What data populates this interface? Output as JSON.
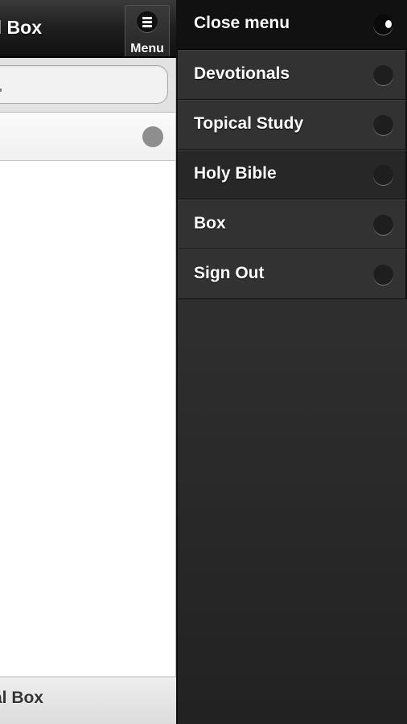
{
  "header": {
    "title": "l Box",
    "menu_button_label": "Menu",
    "menu_icon": "hamburger-icon"
  },
  "search": {
    "value": "",
    "placeholder": "",
    "icon": "search-icon"
  },
  "list": {
    "items": [
      {
        "label": "",
        "indicator": "circle-icon",
        "indicator_color": "#8e8e8e"
      }
    ]
  },
  "footer": {
    "title": "al Box"
  },
  "panel": {
    "items": [
      {
        "label": "Close menu",
        "icon": "close-menu-icon"
      },
      {
        "label": "Devotionals",
        "icon": "circle-icon"
      },
      {
        "label": "Topical Study",
        "icon": "circle-icon"
      },
      {
        "label": "Holy Bible",
        "icon": "circle-icon"
      },
      {
        "label": "Box",
        "icon": "circle-icon"
      },
      {
        "label": "Sign Out",
        "icon": "circle-icon"
      }
    ]
  },
  "colors": {
    "header_bg": "#1e1e1e",
    "panel_bg": "#2d2d2d",
    "panel_active_bg": "#111111",
    "page_bg": "#ffffff"
  }
}
